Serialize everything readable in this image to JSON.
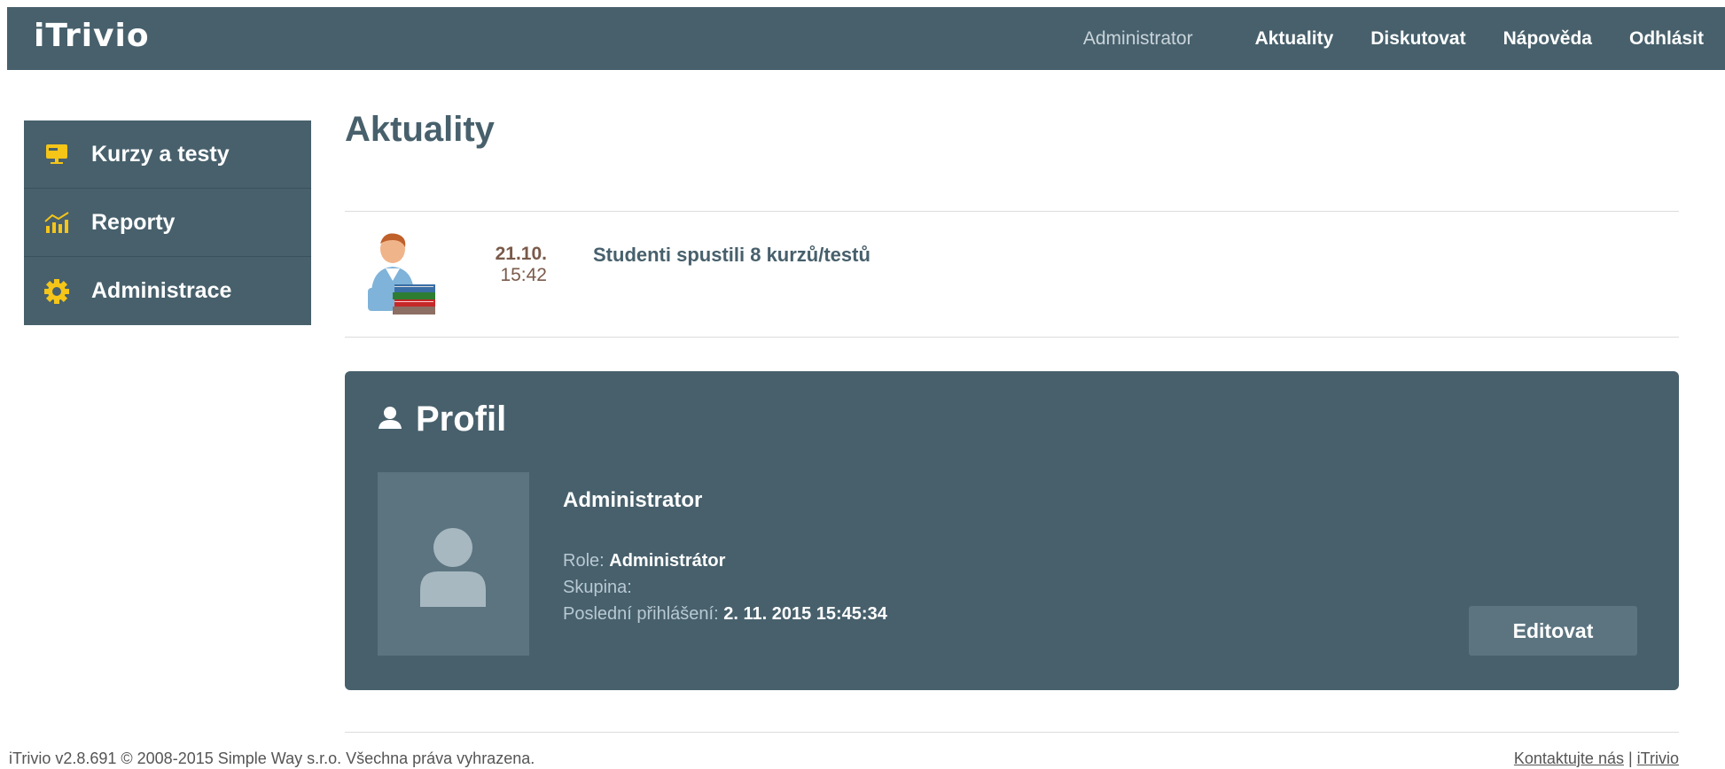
{
  "header": {
    "logo": "iTrivio",
    "user": "Administrator",
    "nav": [
      "Aktuality",
      "Diskutovat",
      "Nápověda",
      "Odhlásit"
    ]
  },
  "sidebar": {
    "items": [
      {
        "label": "Kurzy a testy",
        "icon": "monitor-icon"
      },
      {
        "label": "Reporty",
        "icon": "chart-icon"
      },
      {
        "label": "Administrace",
        "icon": "gear-icon"
      }
    ]
  },
  "main": {
    "title": "Aktuality",
    "news": [
      {
        "date": "21.10.",
        "time": "15:42",
        "text": "Studenti spustili 8 kurzů/testů",
        "icon": "student-books-icon"
      }
    ]
  },
  "profile": {
    "title": "Profil",
    "name": "Administrator",
    "role_label": "Role:",
    "role_value": "Administrátor",
    "group_label": "Skupina:",
    "group_value": "",
    "last_login_label": "Poslední přihlášení:",
    "last_login_value": "2. 11. 2015 15:45:34",
    "edit_label": "Editovat"
  },
  "footer": {
    "copyright": "iTrivio v2.8.691 © 2008-2015 Simple Way s.r.o. Všechna práva vyhrazena.",
    "contact": "Kontaktujte nás",
    "separator": " | ",
    "brand_link": "iTrivio"
  },
  "colors": {
    "accent": "#47606c",
    "icon_yellow": "#f5c518"
  }
}
